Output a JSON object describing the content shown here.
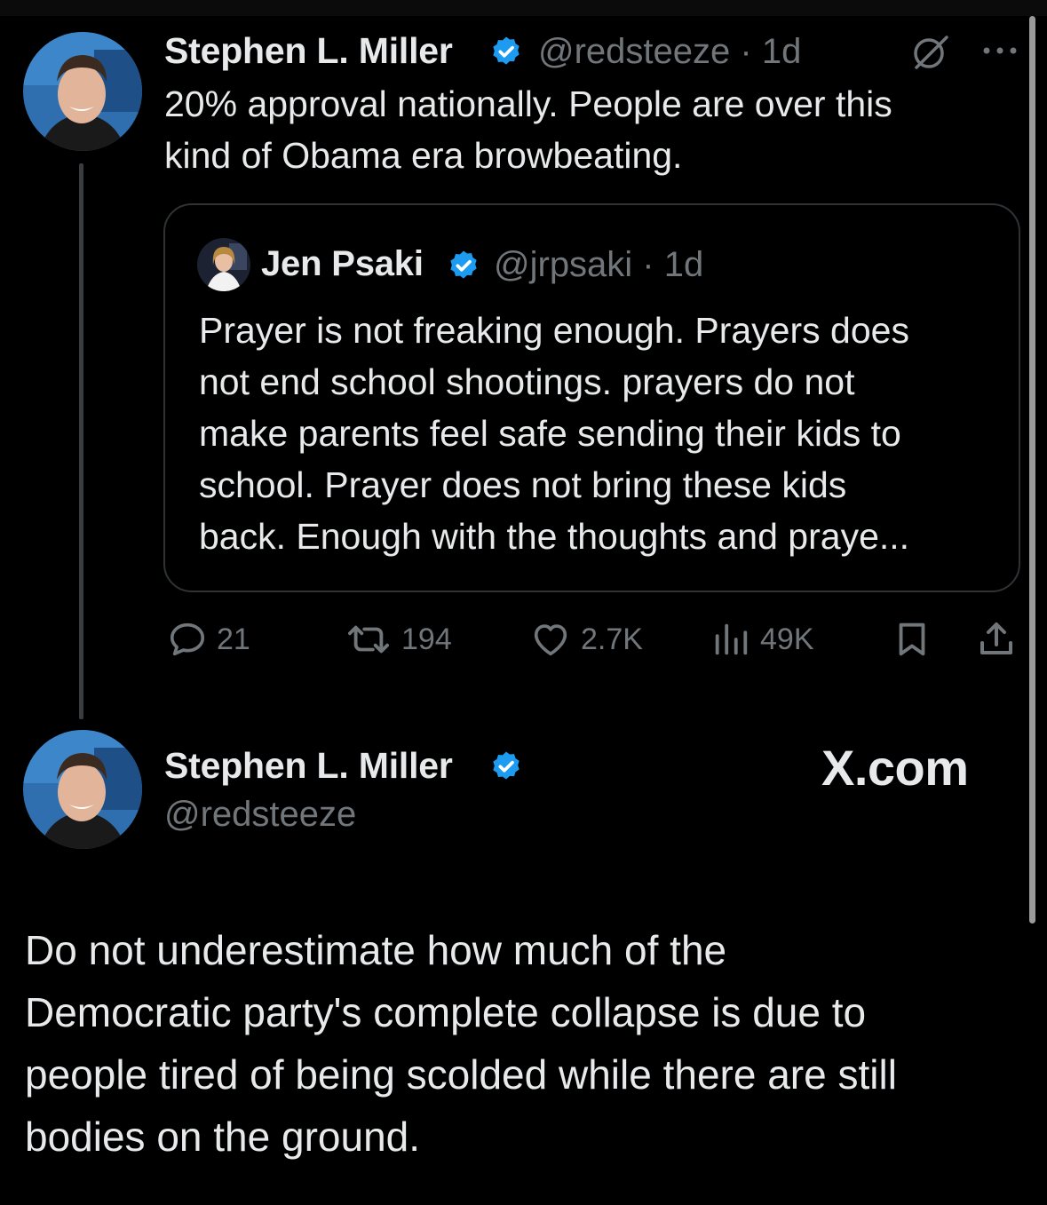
{
  "tweet": {
    "author_name": "Stephen L. Miller",
    "handle_time": "@redsteeze · 1d",
    "text": "20% approval nationally. People are over this\nkind of Obama era browbeating.",
    "quote": {
      "author_name": "Jen Psaki",
      "handle_time": "@jrpsaki · 1d",
      "text": "Prayer is not freaking enough.  Prayers does\nnot end school shootings. prayers do not\nmake parents feel safe sending their kids to\nschool.  Prayer does not bring these kids\nback. Enough with the thoughts and praye..."
    },
    "stats": {
      "replies": "21",
      "reposts": "194",
      "likes": "2.7K",
      "views": "49K"
    },
    "icons": [
      "grok-icon",
      "more-options-icon",
      "reply-icon",
      "repost-icon",
      "like-icon",
      "views-icon",
      "bookmark-icon",
      "share-icon",
      "verified-badge-icon"
    ]
  },
  "reply": {
    "author_name": "Stephen L. Miller",
    "handle": "@redsteeze",
    "brand": "X.com",
    "text": "Do not underestimate how much of the\nDemocratic party's complete collapse is due to\npeople tired of being scolded while there are  still\nbodies on the ground."
  },
  "colors": {
    "background": "#000000",
    "text_primary": "#e7e9ea",
    "text_secondary": "#71767b",
    "verified_blue": "#1d9bf0",
    "border": "#2f3336"
  }
}
